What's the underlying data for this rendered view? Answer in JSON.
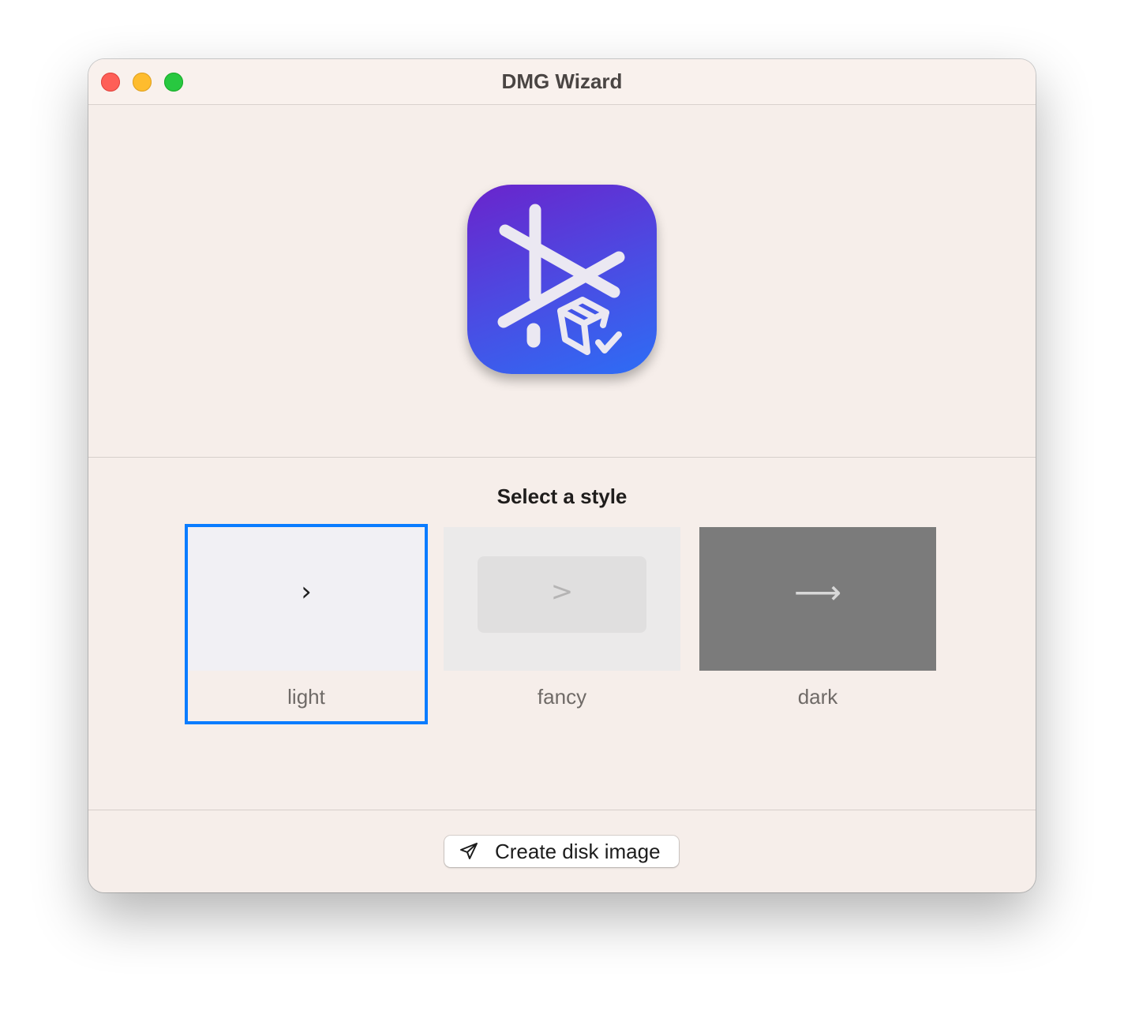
{
  "window": {
    "title": "DMG Wizard",
    "traffic_lights": [
      "close",
      "minimize",
      "zoom"
    ]
  },
  "app_icon": {
    "name": "dmg-wizard-app-icon",
    "colors": [
      "#6a24cc",
      "#2d6df5"
    ]
  },
  "style_picker": {
    "title": "Select a style",
    "selected": "light",
    "styles": [
      {
        "label": "light",
        "glyph": "›"
      },
      {
        "label": "fancy",
        "glyph": ">"
      },
      {
        "label": "dark",
        "glyph": "⟶"
      }
    ]
  },
  "actions": {
    "create_label": "Create disk image",
    "create_icon": "paper-plane-icon"
  },
  "colors": {
    "accent": "#0a7cff",
    "window_bg": "#f6eeea"
  }
}
